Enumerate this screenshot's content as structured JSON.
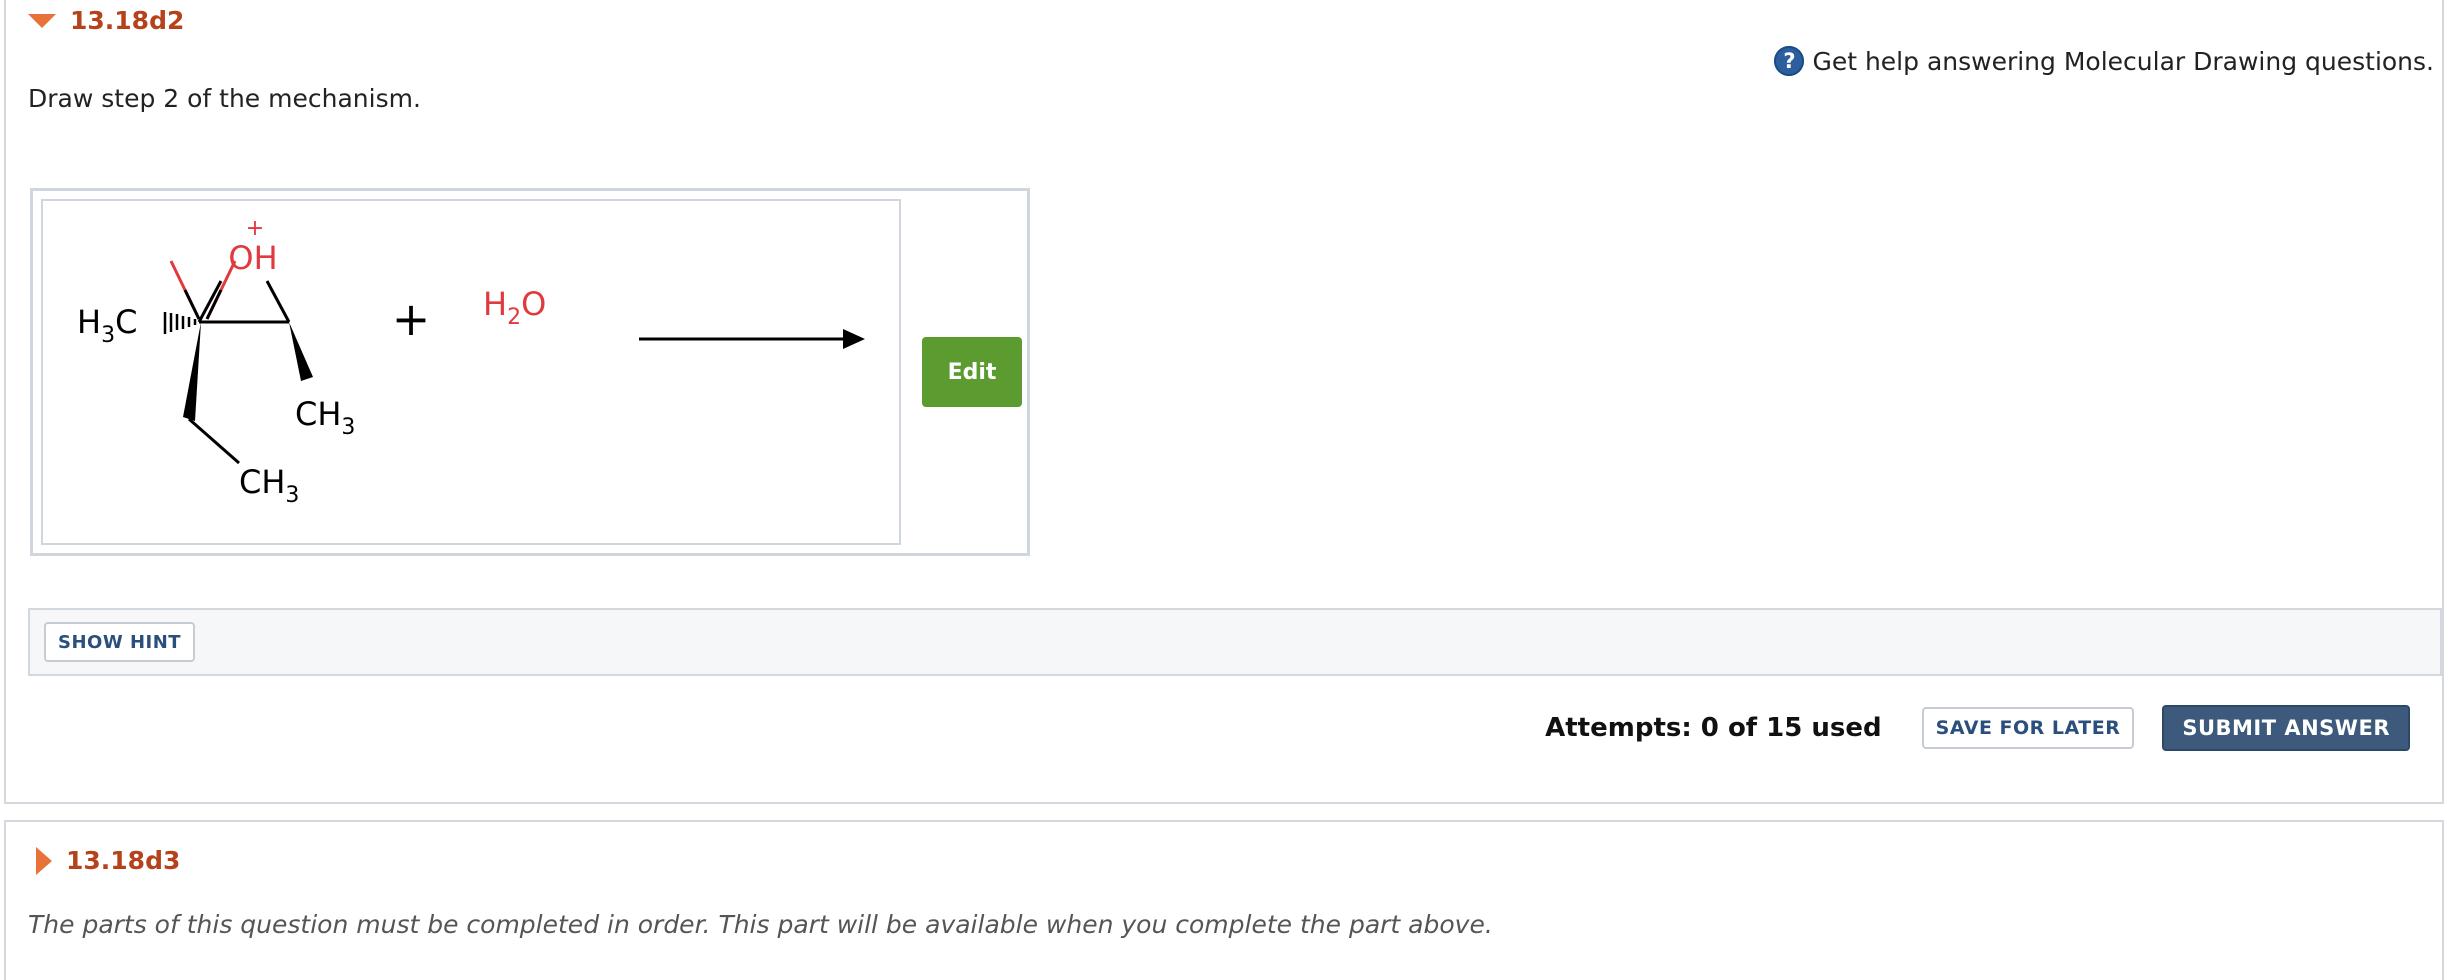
{
  "part1": {
    "title": "13.18d2",
    "help_text": "Get help answering Molecular Drawing questions.",
    "help_icon": "?",
    "question": "Draw step 2 of the mechanism.",
    "drawing": {
      "oh_label": "OH",
      "oh_charge": "+",
      "h3c_label": "H",
      "h3c_sub": "3",
      "h3c_c": "C",
      "ch3_upper": "CH",
      "ch3_upper_sub": "3",
      "ch3_lower": "CH",
      "ch3_lower_sub": "3",
      "plus": "+",
      "h2o_h": "H",
      "h2o_sub": "2",
      "h2o_o": "O"
    },
    "edit_label": "Edit",
    "hint_label": "SHOW HINT",
    "attempts": "Attempts: 0 of 15 used",
    "save_label": "SAVE FOR LATER",
    "submit_label": "SUBMIT ANSWER"
  },
  "part2": {
    "title": "13.18d3",
    "message": "The parts of this question must be completed in order. This part will be available when you complete the part above."
  },
  "colors": {
    "title": "#b5421a",
    "caret": "#e8733a",
    "edit_button": "#5b9b30",
    "submit_button": "#3d5a7d",
    "atom_red": "#e0393e"
  }
}
